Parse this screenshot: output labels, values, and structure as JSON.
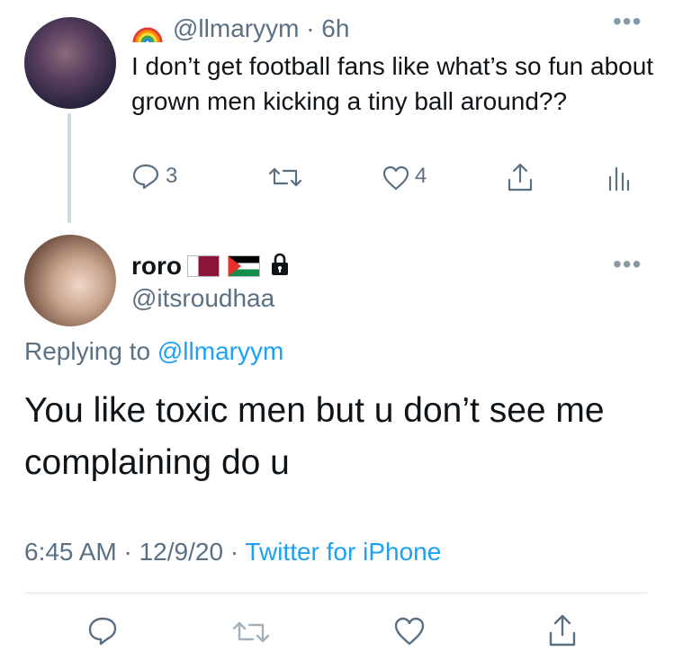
{
  "tweet1": {
    "handle": "@llmaryym",
    "time": "· 6h",
    "text": "I don’t get football fans like what’s so fun about grown men kicking a tiny ball around??",
    "reply_count": "3",
    "like_count": "4",
    "badge_icon": "rainbow-emoji"
  },
  "tweet2": {
    "display_name": "roro",
    "handle": "@itsroudhaa",
    "replying_prefix": "Replying to",
    "replying_to": "@llmaryym",
    "text": "You like toxic men but u don’t see me complaining do u",
    "timestamp": "6:45 AM · 12/9/20 ·",
    "source": "Twitter for iPhone",
    "name_icons": [
      "qatar-flag-emoji",
      "palestine-flag-emoji",
      "lock-icon"
    ]
  },
  "colors": {
    "link": "#1da1f2",
    "muted": "#5b7083",
    "text": "#0f1419"
  }
}
